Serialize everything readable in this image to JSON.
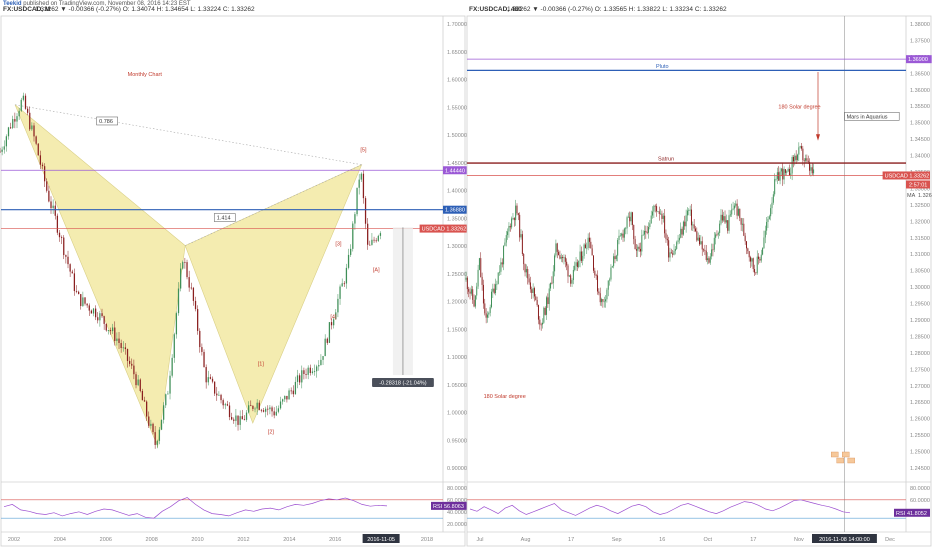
{
  "header": {
    "author": "Teekid",
    "published": "published on TradingView.com, November 08, 2016 14:23 EST"
  },
  "colors": {
    "up": "#3e8f57",
    "down": "#8a1f1f",
    "pattern": "#f4ecb0",
    "price_line": "#d9534f",
    "purple": "#9b59d6",
    "blue": "#2d5fb6",
    "rsi": "#9c4fd0"
  },
  "chart_data": [
    {
      "type": "candlestick",
      "panel": "left",
      "title": "FX:USDCAD, M",
      "ohlc_text": "1.33262  ▼ -0.00366 (-0.27%)  O: 1.34074  H: 1.34654  L: 1.33224  C: 1.33262",
      "annotation_title": "Monthly Chart",
      "x_ticks": [
        "2002",
        "2004",
        "2006",
        "2008",
        "2010",
        "2012",
        "2014",
        "2016",
        "2016-11-05",
        "2018"
      ],
      "y_ticks": [
        "1.70000",
        "1.65000",
        "1.60000",
        "1.55000",
        "1.50000",
        "1.45000",
        "1.40000",
        "1.35000",
        "1.30000",
        "1.25000",
        "1.20000",
        "1.15000",
        "1.10000",
        "1.05000",
        "1.00000",
        "0.95000",
        "0.90000"
      ],
      "ylim": [
        0.87,
        1.74
      ],
      "xlim": [
        2001.6,
        2019.3
      ],
      "series_path": [
        [
          2001.6,
          1.48
        ],
        [
          2002.0,
          1.53
        ],
        [
          2002.5,
          1.58
        ],
        [
          2003.0,
          1.5
        ],
        [
          2003.5,
          1.4
        ],
        [
          2004.0,
          1.32
        ],
        [
          2004.7,
          1.2
        ],
        [
          2005.5,
          1.17
        ],
        [
          2006.3,
          1.12
        ],
        [
          2007.0,
          1.05
        ],
        [
          2007.8,
          0.92
        ],
        [
          2008.3,
          1.02
        ],
        [
          2008.9,
          1.28
        ],
        [
          2009.3,
          1.2
        ],
        [
          2009.8,
          1.05
        ],
        [
          2010.5,
          1.0
        ],
        [
          2011.2,
          0.96
        ],
        [
          2011.8,
          1.0
        ],
        [
          2012.6,
          0.98
        ],
        [
          2013.2,
          1.02
        ],
        [
          2013.8,
          1.06
        ],
        [
          2014.4,
          1.08
        ],
        [
          2015.0,
          1.18
        ],
        [
          2015.5,
          1.26
        ],
        [
          2016.0,
          1.45
        ],
        [
          2016.3,
          1.29
        ],
        [
          2016.8,
          1.33262
        ]
      ],
      "harmonic_points": [
        [
          2002.2,
          1.57
        ],
        [
          2007.9,
          0.915
        ],
        [
          2009.0,
          1.3
        ],
        [
          2011.7,
          0.96
        ],
        [
          2016.05,
          1.455
        ]
      ],
      "hlines": [
        {
          "value": 1.4444,
          "label": "1.44440",
          "color": "#9b59d6"
        },
        {
          "value": 1.3688,
          "label": "1.36880",
          "color": "#2d5fb6"
        },
        {
          "value": 1.33262,
          "label": "USDCAD 1.33262",
          "color": "#d9534f"
        }
      ],
      "ratio_labels": [
        {
          "text": "0.786",
          "x": 2005.5,
          "y": 1.535
        },
        {
          "text": "1.414",
          "x": 2010.2,
          "y": 1.35
        }
      ],
      "wave_labels": [
        {
          "text": "[5]",
          "x": 2016.0,
          "y": 1.48
        },
        {
          "text": "[3]",
          "x": 2015.0,
          "y": 1.3
        },
        {
          "text": "[A]",
          "x": 2016.5,
          "y": 1.25
        },
        {
          "text": "[4]",
          "x": 2014.8,
          "y": 1.16
        },
        {
          "text": "[1]",
          "x": 2011.9,
          "y": 1.07
        },
        {
          "text": "[2]",
          "x": 2012.3,
          "y": 0.94
        }
      ],
      "measure": {
        "text": "-0.28318 (-21.04%)",
        "x": 2017.7,
        "top": 1.335,
        "bottom": 1.052
      },
      "rsi": {
        "label": "RSI",
        "value": "56.8063",
        "ticks": [
          "80.0000",
          "60.0000",
          "40.0000",
          "20.0000"
        ],
        "upper": 70,
        "lower": 30,
        "values": [
          55,
          60,
          48,
          45,
          40,
          38,
          42,
          35,
          40,
          44,
          38,
          45,
          50,
          48,
          42,
          36,
          40,
          32,
          30,
          45,
          55,
          68,
          75,
          60,
          48,
          40,
          38,
          35,
          42,
          48,
          45,
          50,
          52,
          48,
          55,
          60,
          58,
          62,
          68,
          72,
          70,
          74,
          68,
          60,
          56,
          58,
          56.8
        ]
      }
    },
    {
      "type": "candlestick",
      "panel": "right",
      "title": "FX:USDCAD, 480",
      "ohlc_text": "1.33262  ▼ -0.00366 (-0.27%)  O: 1.33565  H: 1.33822  L: 1.33234  C: 1.33262",
      "x_ticks": [
        "Jul",
        "Aug",
        "17",
        "Sep",
        "16",
        "Oct",
        "17",
        "Nov",
        "2016-11-08 14:00:00",
        "Dec"
      ],
      "y_ticks": [
        "1.38000",
        "1.37500",
        "1.37000",
        "1.36500",
        "1.36000",
        "1.35500",
        "1.35000",
        "1.34500",
        "1.34000",
        "1.33500",
        "1.33000",
        "1.32500",
        "1.32000",
        "1.31500",
        "1.31000",
        "1.30500",
        "1.30000",
        "1.29500",
        "1.29000",
        "1.28500",
        "1.28000",
        "1.27500",
        "1.27000",
        "1.26500",
        "1.26000",
        "1.25500",
        "1.25000",
        "1.24500"
      ],
      "ylim": [
        1.2405,
        1.3825
      ],
      "xlim": [
        0,
        100
      ],
      "series_path": [
        [
          0,
          1.3
        ],
        [
          4,
          1.292
        ],
        [
          6,
          1.306
        ],
        [
          9,
          1.286
        ],
        [
          12,
          1.296
        ],
        [
          16,
          1.305
        ],
        [
          20,
          1.318
        ],
        [
          23,
          1.322
        ],
        [
          27,
          1.303
        ],
        [
          31,
          1.295
        ],
        [
          34,
          1.286
        ],
        [
          38,
          1.296
        ],
        [
          41,
          1.31
        ],
        [
          44,
          1.307
        ],
        [
          48,
          1.3
        ],
        [
          52,
          1.307
        ],
        [
          56,
          1.314
        ],
        [
          59,
          1.3
        ],
        [
          62,
          1.292
        ],
        [
          65,
          1.3
        ],
        [
          69,
          1.311
        ],
        [
          72,
          1.316
        ],
        [
          75,
          1.32
        ],
        [
          77,
          1.307
        ],
        [
          80,
          1.312
        ],
        [
          83,
          1.318
        ],
        [
          86,
          1.323
        ],
        [
          89,
          1.321
        ],
        [
          92,
          1.309
        ],
        [
          95,
          1.31
        ],
        [
          98,
          1.315
        ],
        [
          101,
          1.322
        ],
        [
          104,
          1.315
        ],
        [
          107,
          1.31
        ],
        [
          110,
          1.306
        ],
        [
          113,
          1.312
        ],
        [
          116,
          1.32
        ],
        [
          119,
          1.317
        ],
        [
          122,
          1.324
        ],
        [
          125,
          1.318
        ],
        [
          128,
          1.31
        ],
        [
          131,
          1.303
        ],
        [
          134,
          1.308
        ],
        [
          137,
          1.318
        ],
        [
          140,
          1.329
        ],
        [
          143,
          1.334
        ],
        [
          146,
          1.332
        ],
        [
          149,
          1.338
        ],
        [
          152,
          1.34
        ],
        [
          155,
          1.336
        ],
        [
          158,
          1.33262
        ]
      ],
      "x_max": 200,
      "hlines": [
        {
          "value": 1.369,
          "label": "1.36900",
          "color": "#9b59d6",
          "name": ""
        },
        {
          "value": 1.3655,
          "label": "",
          "color": "#2d5fb6",
          "name": "Pluto"
        },
        {
          "value": 1.3365,
          "label": "",
          "color": "#8a1f1f",
          "name": "Satrun"
        },
        {
          "value": 1.33262,
          "label": "USDCAD 1.33262",
          "color": "#d9534f",
          "name": ""
        }
      ],
      "ma": {
        "label": "MA",
        "value": "1.32648"
      },
      "countdown": "2:57:01",
      "annotations": [
        {
          "text": "180 Solar degree",
          "x": 142,
          "y": 1.3535
        },
        {
          "text": "Mars in Aquarius",
          "x": 173,
          "y": 1.3505
        },
        {
          "text": "180 Solar degree",
          "x": 8,
          "y": 1.263
        }
      ],
      "rsi": {
        "label": "RSI",
        "value": "41.8052",
        "ticks": [
          "80.0000",
          "60.0000",
          "40.0000"
        ],
        "upper": 70,
        "lower": 30,
        "values": [
          50,
          45,
          55,
          48,
          40,
          52,
          58,
          46,
          38,
          44,
          50,
          56,
          62,
          48,
          42,
          36,
          44,
          52,
          58,
          54,
          46,
          40,
          48,
          56,
          60,
          55,
          44,
          38,
          42,
          50,
          58,
          62,
          56,
          50,
          44,
          40,
          46,
          54,
          60,
          66,
          64,
          58,
          50,
          46,
          52,
          60,
          68,
          70,
          66,
          62,
          58,
          55,
          50,
          44,
          41.8
        ]
      }
    }
  ]
}
